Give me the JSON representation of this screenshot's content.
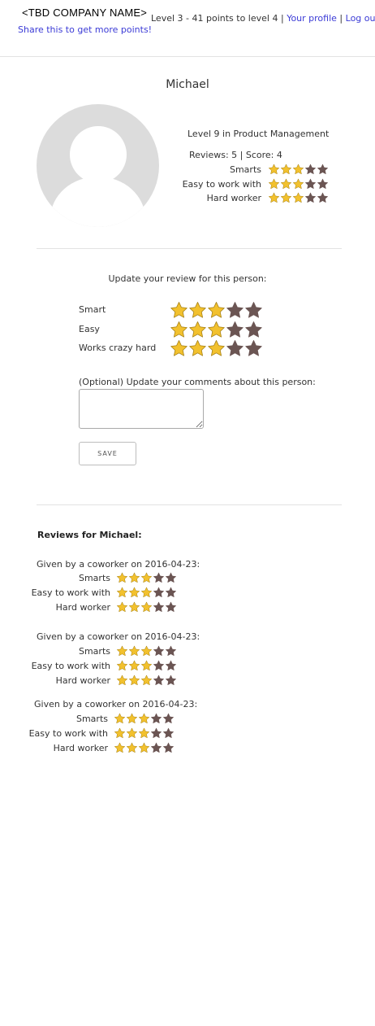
{
  "header": {
    "company_name": "<TBD COMPANY NAME>",
    "share_link": "Share this to get more points!",
    "level_status": "Level 3 - 41 points to level 4",
    "separator": "|",
    "profile_link": "Your profile",
    "logout_link": "Log out"
  },
  "profile": {
    "name": "Michael",
    "level_text": "Level 9 in Product Management",
    "reviews_score": "Reviews: 5 | Score: 4",
    "stats": [
      {
        "label": "Smarts",
        "rating": 3
      },
      {
        "label": "Easy to work with",
        "rating": 3
      },
      {
        "label": "Hard worker",
        "rating": 3
      }
    ]
  },
  "update_form": {
    "title": "Update your review for this person:",
    "ratings": [
      {
        "label": "Smart",
        "rating": 3
      },
      {
        "label": "Easy",
        "rating": 3
      },
      {
        "label": "Works crazy hard",
        "rating": 3
      }
    ],
    "comment_label": "(Optional) Update your comments about this person:",
    "comment_value": "",
    "save_label": "SAVE"
  },
  "reviews": {
    "title": "Reviews for Michael:",
    "items": [
      {
        "given": "Given by a coworker on 2016-04-23:",
        "rows": [
          {
            "label": "Smarts",
            "rating": 3
          },
          {
            "label": "Easy to work with",
            "rating": 3
          },
          {
            "label": "Hard worker",
            "rating": 3
          }
        ]
      },
      {
        "given": "Given by a coworker on 2016-04-23:",
        "rows": [
          {
            "label": "Smarts",
            "rating": 3
          },
          {
            "label": "Easy to work with",
            "rating": 3
          },
          {
            "label": "Hard worker",
            "rating": 3
          }
        ]
      },
      {
        "given": "Given by a coworker on 2016-04-23:",
        "rows": [
          {
            "label": "Smarts",
            "rating": 3
          },
          {
            "label": "Easy to work with",
            "rating": 3
          },
          {
            "label": "Hard worker",
            "rating": 3
          }
        ]
      }
    ]
  },
  "colors": {
    "link": "#3b3bd6",
    "star_filled": "#f2c12e",
    "star_empty": "#6b5553"
  }
}
